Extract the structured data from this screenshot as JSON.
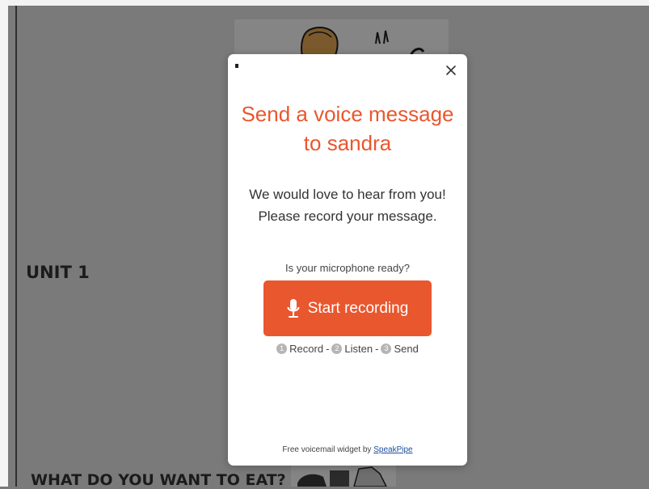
{
  "page": {
    "unit_heading": "UNIT 1",
    "section_heading": "WHAT DO YOU WANT TO EAT?"
  },
  "modal": {
    "title_line1": "Send a voice message",
    "title_line2": "to sandra",
    "subtitle_line1": "We would love to hear from you!",
    "subtitle_line2": "Please record your message.",
    "mic_question": "Is your microphone ready?",
    "record_button_label": "Start recording",
    "close_label": "X",
    "steps": [
      {
        "num": "1",
        "label": "Record"
      },
      {
        "num": "2",
        "label": "Listen"
      },
      {
        "num": "3",
        "label": "Send"
      }
    ],
    "step_separator": "-",
    "footer_text": "Free voicemail widget by",
    "footer_link": "SpeakPipe"
  },
  "icons": {
    "close": "close-icon",
    "microphone": "microphone-icon"
  },
  "colors": {
    "accent": "#e9572e",
    "overlay": "#7a7a7a",
    "link": "#1c4d9c",
    "step_circle": "#b5b5b5"
  }
}
